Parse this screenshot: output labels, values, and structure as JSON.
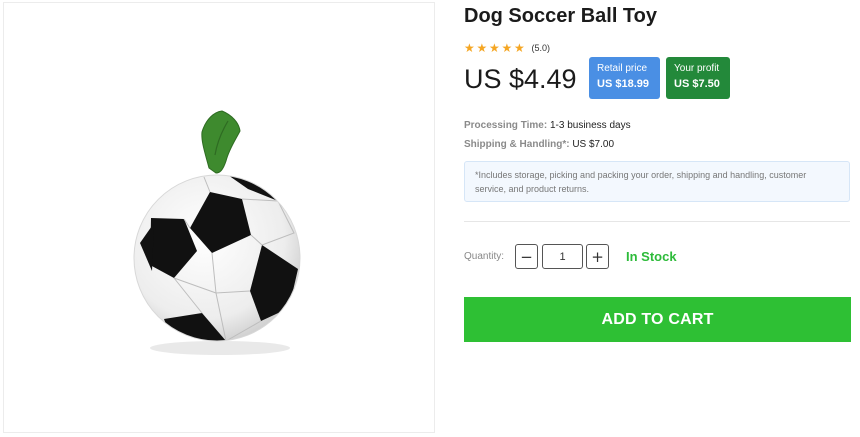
{
  "product": {
    "title": "Dog Soccer Ball Toy",
    "image_alt": "soccer ball toy with green loop handle",
    "rating_value": "(5.0)",
    "rating_stars": 5,
    "price": "US $4.49"
  },
  "badges": {
    "retail_label": "Retail price",
    "retail_value": "US $18.99",
    "profit_label": "Your profit",
    "profit_value": "US $7.50"
  },
  "details": {
    "processing_label": "Processing Time:",
    "processing_value": "1-3 business days",
    "shipping_label": "Shipping & Handling*:",
    "shipping_value": "US $7.00",
    "note": "*Includes storage, picking and packing your order, shipping and handling, customer service, and product returns."
  },
  "purchase": {
    "quantity_label": "Quantity:",
    "quantity_value": "1",
    "minus_symbol": "−",
    "plus_symbol": "+",
    "stock_status": "In Stock",
    "add_to_cart_label": "ADD TO CART"
  },
  "colors": {
    "star": "#f5a623",
    "retail_badge": "#4a8fe4",
    "profit_badge": "#23893a",
    "in_stock": "#2dbb3a",
    "cart_button": "#2ec034",
    "handle_green": "#3e8a2e"
  },
  "icons": {
    "star": "star-icon"
  }
}
